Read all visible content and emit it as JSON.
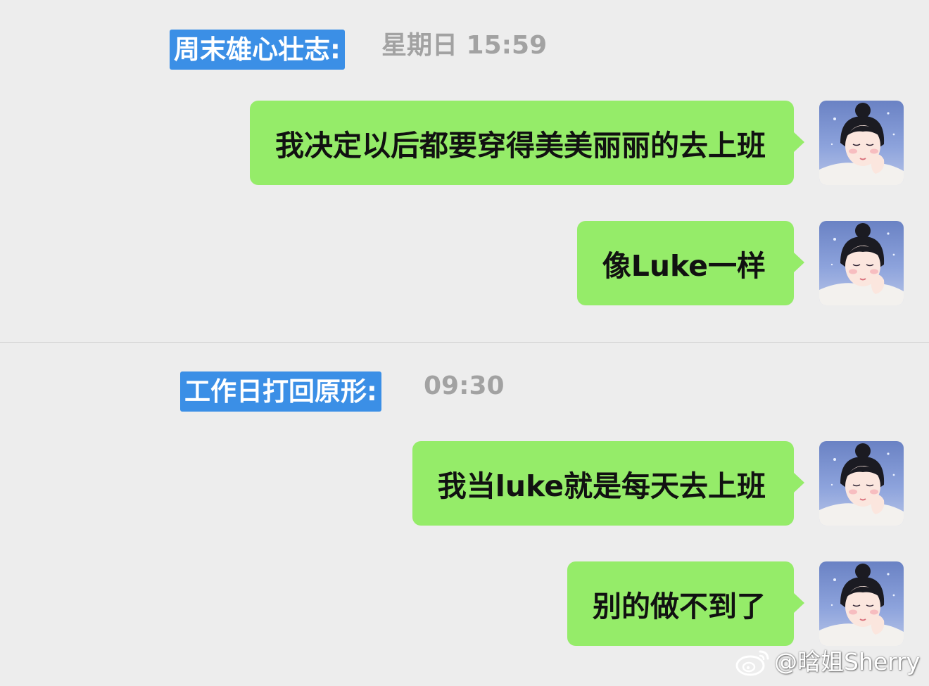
{
  "sections": [
    {
      "label": "周末雄心壮志:",
      "time": "星期日 15:59",
      "messages": [
        "我决定以后都要穿得美美丽丽的去上班",
        "像Luke一样"
      ]
    },
    {
      "label": "工作日打回原形:",
      "time": "09:30",
      "messages": [
        "我当luke就是每天去上班",
        "别的做不到了"
      ]
    }
  ],
  "colors": {
    "background": "#ededed",
    "bubble": "#95ec69",
    "label": "#3b8fe6",
    "timestamp": "#a2a2a2"
  },
  "watermark": {
    "icon": "weibo-icon",
    "text": "@晗姐Sherry"
  }
}
